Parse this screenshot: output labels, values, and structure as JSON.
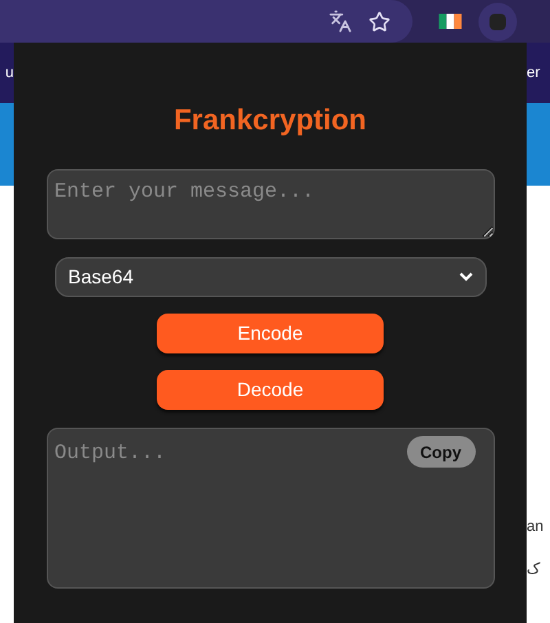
{
  "background_page": {
    "left_texts": [
      "u"
    ],
    "right_texts": [
      "er",
      "an",
      "ک"
    ]
  },
  "popup": {
    "title": "Frankcryption",
    "message_field": {
      "placeholder": "Enter your message..."
    },
    "method_select": {
      "value": "Base64"
    },
    "buttons": [
      "Encode",
      "Decode"
    ],
    "output_field": {
      "placeholder": "Output..."
    },
    "copy_button": "Copy"
  }
}
